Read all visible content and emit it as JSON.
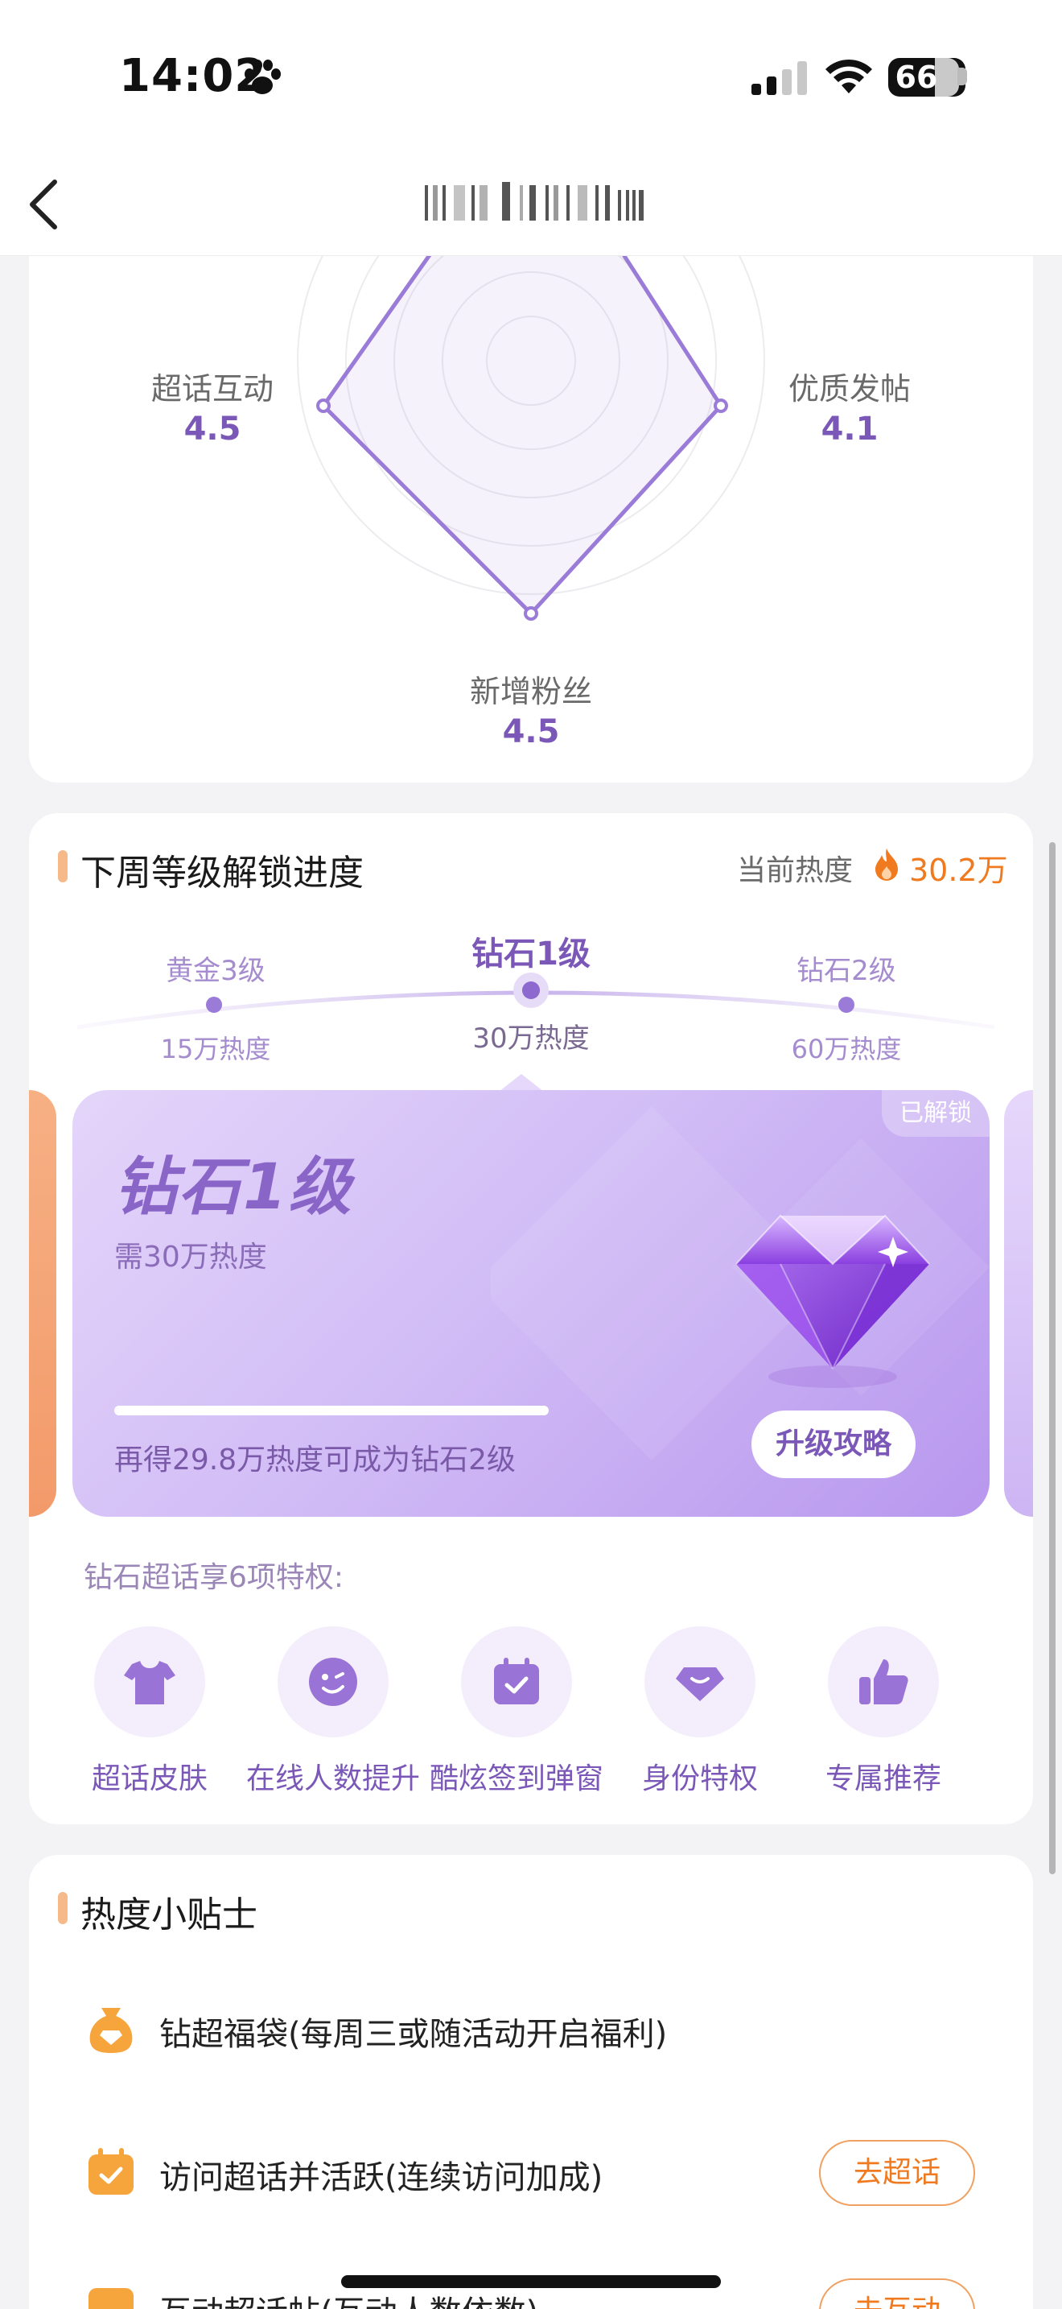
{
  "status_bar": {
    "time": "14:02",
    "battery": "66"
  },
  "nav": {
    "title": "",
    "back_icon": "chevron-left-icon"
  },
  "radar": {
    "axes": [
      {
        "label": "超话互动",
        "value": "4.5"
      },
      {
        "label": "优质发帖",
        "value": "4.1"
      },
      {
        "label": "新增粉丝",
        "value": "4.5"
      }
    ],
    "accent": "#9b7bd8"
  },
  "level_section": {
    "title": "下周等级解锁进度",
    "current_heat_label": "当前热度",
    "current_heat_value": "30.2万",
    "track": [
      {
        "name": "黄金3级",
        "need": "15万热度"
      },
      {
        "name": "钻石1级",
        "need": "30万热度",
        "current": true
      },
      {
        "name": "钻石2级",
        "need": "60万热度"
      }
    ],
    "card": {
      "badge": "已解锁",
      "level_name": "钻石1级",
      "need": "需30万热度",
      "progress": 1.0,
      "hint": "再得29.8万热度可成为钻石2级",
      "button": "升级攻略"
    },
    "privilege_title": "钻石超话享6项特权:",
    "privileges": [
      {
        "label": "超话皮肤",
        "icon": "tshirt-icon"
      },
      {
        "label": "在线人数提升",
        "icon": "smile-face-icon"
      },
      {
        "label": "酷炫签到弹窗",
        "icon": "calendar-check-icon"
      },
      {
        "label": "身份特权",
        "icon": "diamond-badge-icon"
      },
      {
        "label": "专属推荐",
        "icon": "thumbs-up-icon"
      }
    ]
  },
  "tips_section": {
    "title": "热度小贴士",
    "items": [
      {
        "text": "钻超福袋(每周三或随活动开启福利)",
        "icon": "lucky-bag-icon",
        "button": ""
      },
      {
        "text": "访问超话并活跃(连续访问加成)",
        "icon": "calendar-icon",
        "button": "去超话"
      },
      {
        "text": "互动超话帖(互动人数依数)",
        "icon": "chat-icon",
        "button": "去互动"
      }
    ]
  },
  "colors": {
    "purple": "#7b58b8",
    "orange": "#f07a1f",
    "accent_bar": "#f5b98a"
  }
}
